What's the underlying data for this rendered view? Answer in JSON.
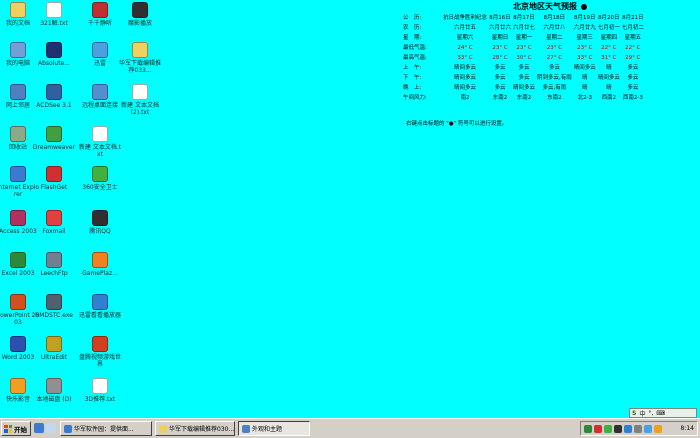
{
  "desktop_icons": [
    {
      "label": "我的文档",
      "color": "#f0d060"
    },
    {
      "label": "321解.txt",
      "color": "#ffffff"
    },
    {
      "label": "千千静听",
      "color": "#c03030"
    },
    {
      "label": "魔影播放",
      "color": "#303030"
    },
    {
      "label": "我的电脑",
      "color": "#6fa0d8"
    },
    {
      "label": "Absolute...",
      "color": "#203070"
    },
    {
      "label": "迅雷",
      "color": "#4aa0e0"
    },
    {
      "label": "华军下载编辑推荐033...",
      "color": "#f0d060"
    },
    {
      "label": "网上邻居",
      "color": "#5080c0"
    },
    {
      "label": "ACDSee 3.1",
      "color": "#3060a0"
    },
    {
      "label": "远程桌面连接",
      "color": "#5090d0"
    },
    {
      "label": "新建 文本文档 (2).txt",
      "color": "#ffffff"
    },
    {
      "label": "回收站",
      "color": "#8aaa8a"
    },
    {
      "label": "Dreamweaver",
      "color": "#40a040"
    },
    {
      "label": "新建 文本文档.txt",
      "color": "#ffffff"
    },
    {
      "label": "Internet Explorer",
      "color": "#3a7ad0"
    },
    {
      "label": "FlashGet",
      "color": "#d03030"
    },
    {
      "label": "360安全卫士",
      "color": "#40b040"
    },
    {
      "label": "Access 2003",
      "color": "#b03060"
    },
    {
      "label": "Foxmail",
      "color": "#e04040"
    },
    {
      "label": "腾讯QQ",
      "color": "#303030"
    },
    {
      "label": "Excel 2003",
      "color": "#2a8a3a"
    },
    {
      "label": "LeechFtp",
      "color": "#708090"
    },
    {
      "label": "GamePlaz...",
      "color": "#f08020"
    },
    {
      "label": "PowerPoint 2003",
      "color": "#d05020"
    },
    {
      "label": "RMDSTC.exe",
      "color": "#506070"
    },
    {
      "label": "迅雷看看播放器",
      "color": "#3080d0"
    },
    {
      "label": "Word 2003",
      "color": "#2a50b0"
    },
    {
      "label": "UltraEdit",
      "color": "#c0a020"
    },
    {
      "label": "盘腾视频游戏世界",
      "color": "#d04020"
    },
    {
      "label": "快乐影音",
      "color": "#f0a020"
    },
    {
      "label": "本地磁盘 (D)",
      "color": "#909090"
    },
    {
      "label": "3D推荐.txt",
      "color": "#ffffff"
    }
  ],
  "weather": {
    "title": "北京地区天气预报",
    "header": [
      "公　历:",
      "抗日战争胜利纪念",
      "8月16日",
      "8月17日",
      "8月18日",
      "8月19日",
      "8月20日",
      "8月21日"
    ],
    "rows": [
      {
        "label": "农　历:",
        "values": [
          "六月廿五",
          "六月廿六",
          "六月廿七",
          "六月廿八",
          "六月廿九",
          "七月初一",
          "七月初二"
        ]
      },
      {
        "label": "星　期:",
        "values": [
          "星期六",
          "星期日",
          "星期一",
          "星期二",
          "星期三",
          "星期四",
          "星期五"
        ]
      },
      {
        "label": "最低气温:",
        "values": [
          "24° C",
          "23° C",
          "23° C",
          "23° C",
          "23° C",
          "22° C",
          "22° C"
        ],
        "temp": true
      },
      {
        "label": "最高气温:",
        "values": [
          "33° C",
          "28° C",
          "30° C",
          "27° C",
          "33° C",
          "31° C",
          "29° C"
        ],
        "temp": true
      },
      {
        "label": "上　午:",
        "values": [
          "晴间多云",
          "多云",
          "多云",
          "多云",
          "晴间多云",
          "晴",
          "多云"
        ]
      },
      {
        "label": "下　午:",
        "values": [
          "晴间多云",
          "多云",
          "多云",
          "阴到多云,有雨",
          "晴",
          "晴间多云",
          "多云"
        ]
      },
      {
        "label": "晚　上:",
        "values": [
          "晴间多云",
          "多云",
          "晴间多云",
          "多云,有雨",
          "晴",
          "晴",
          "多云"
        ]
      },
      {
        "label": "午间风力:",
        "values": [
          "南2",
          "东南2",
          "东南2",
          "东南2",
          "北2-3",
          "西南2",
          "西南2-3"
        ]
      }
    ],
    "note": "右键点击标题的 \"●\" 符号可以进行设置。"
  },
  "taskbar": {
    "start_label": "开始",
    "tasks": [
      {
        "label": "华军软件园：提供面...",
        "color": "#3a7ad0",
        "active": false
      },
      {
        "label": "华军下载编辑推荐030...",
        "color": "#f0d060",
        "active": false
      },
      {
        "label": "外观和主题",
        "color": "#5080c0",
        "active": true
      }
    ],
    "clock": "8:14",
    "ime_label": "中"
  }
}
